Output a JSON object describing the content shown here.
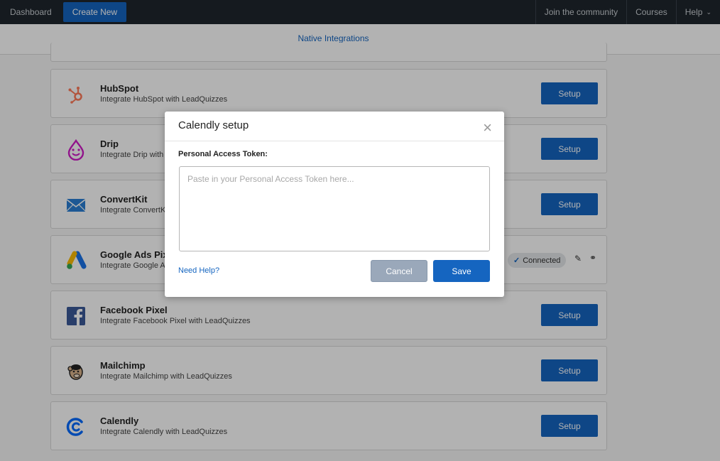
{
  "nav": {
    "dashboard": "Dashboard",
    "create_new": "Create New",
    "community": "Join the community",
    "courses": "Courses",
    "help": "Help"
  },
  "tabs": {
    "active": "Native Integrations"
  },
  "integrations": [
    {
      "name": "HubSpot",
      "desc": "Integrate HubSpot with LeadQuizzes",
      "action": "Setup",
      "icon": "hubspot-icon"
    },
    {
      "name": "Drip",
      "desc": "Integrate Drip with",
      "action": "Setup",
      "icon": "drip-icon"
    },
    {
      "name": "ConvertKit",
      "desc": "Integrate ConvertK",
      "action": "Setup",
      "icon": "convertkit-icon"
    },
    {
      "name": "Google Ads Pix",
      "desc": "Integrate Google A",
      "status": "Connected",
      "icon": "google-ads-icon"
    },
    {
      "name": "Facebook Pixel",
      "desc": "Integrate Facebook Pixel with LeadQuizzes",
      "action": "Setup",
      "icon": "facebook-icon"
    },
    {
      "name": "Mailchimp",
      "desc": "Integrate Mailchimp with LeadQuizzes",
      "action": "Setup",
      "icon": "mailchimp-icon"
    },
    {
      "name": "Calendly",
      "desc": "Integrate Calendly with LeadQuizzes",
      "action": "Setup",
      "icon": "calendly-icon"
    }
  ],
  "modal": {
    "title": "Calendly setup",
    "field_label": "Personal Access Token:",
    "placeholder": "Paste in your Personal Access Token here...",
    "value": "",
    "need_help": "Need Help?",
    "cancel": "Cancel",
    "save": "Save"
  },
  "colors": {
    "brand": "#1565c0",
    "nav_bg": "#1f262d"
  }
}
